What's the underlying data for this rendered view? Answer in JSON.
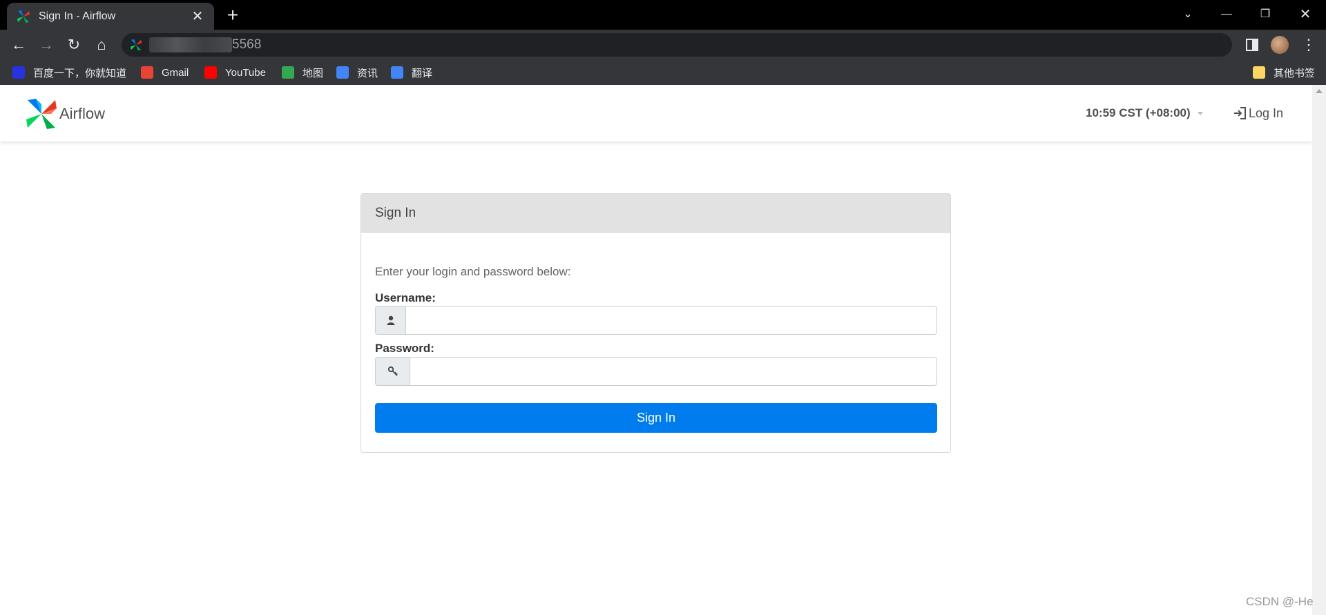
{
  "browser": {
    "tab_title": "Sign In - Airflow",
    "new_tab_symbol": "+",
    "close_symbol": "✕",
    "url_visible": "5568",
    "bookmarks": [
      {
        "label": "百度一下，你就知道",
        "icon": "baidu-icon",
        "color": "#2932e1"
      },
      {
        "label": "Gmail",
        "icon": "gmail-icon",
        "color": "#ea4335"
      },
      {
        "label": "YouTube",
        "icon": "youtube-icon",
        "color": "#ff0000"
      },
      {
        "label": "地图",
        "icon": "maps-icon",
        "color": "#34a853"
      },
      {
        "label": "资讯",
        "icon": "news-icon",
        "color": "#4285f4"
      },
      {
        "label": "翻译",
        "icon": "translate-icon",
        "color": "#4285f4"
      }
    ],
    "other_bookmarks": "其他书签"
  },
  "navbar": {
    "brand": "Airflow",
    "clock": "10:59 CST (+08:00)",
    "login": "Log In"
  },
  "signin": {
    "heading": "Sign In",
    "instructions": "Enter your login and password below:",
    "username_label": "Username:",
    "password_label": "Password:",
    "username_value": "",
    "password_value": "",
    "button": "Sign In"
  },
  "watermark": "CSDN @-He",
  "colors": {
    "primary_button": "#017cee",
    "panel_heading_bg": "#e2e2e2",
    "chrome_dark": "#35363a"
  }
}
